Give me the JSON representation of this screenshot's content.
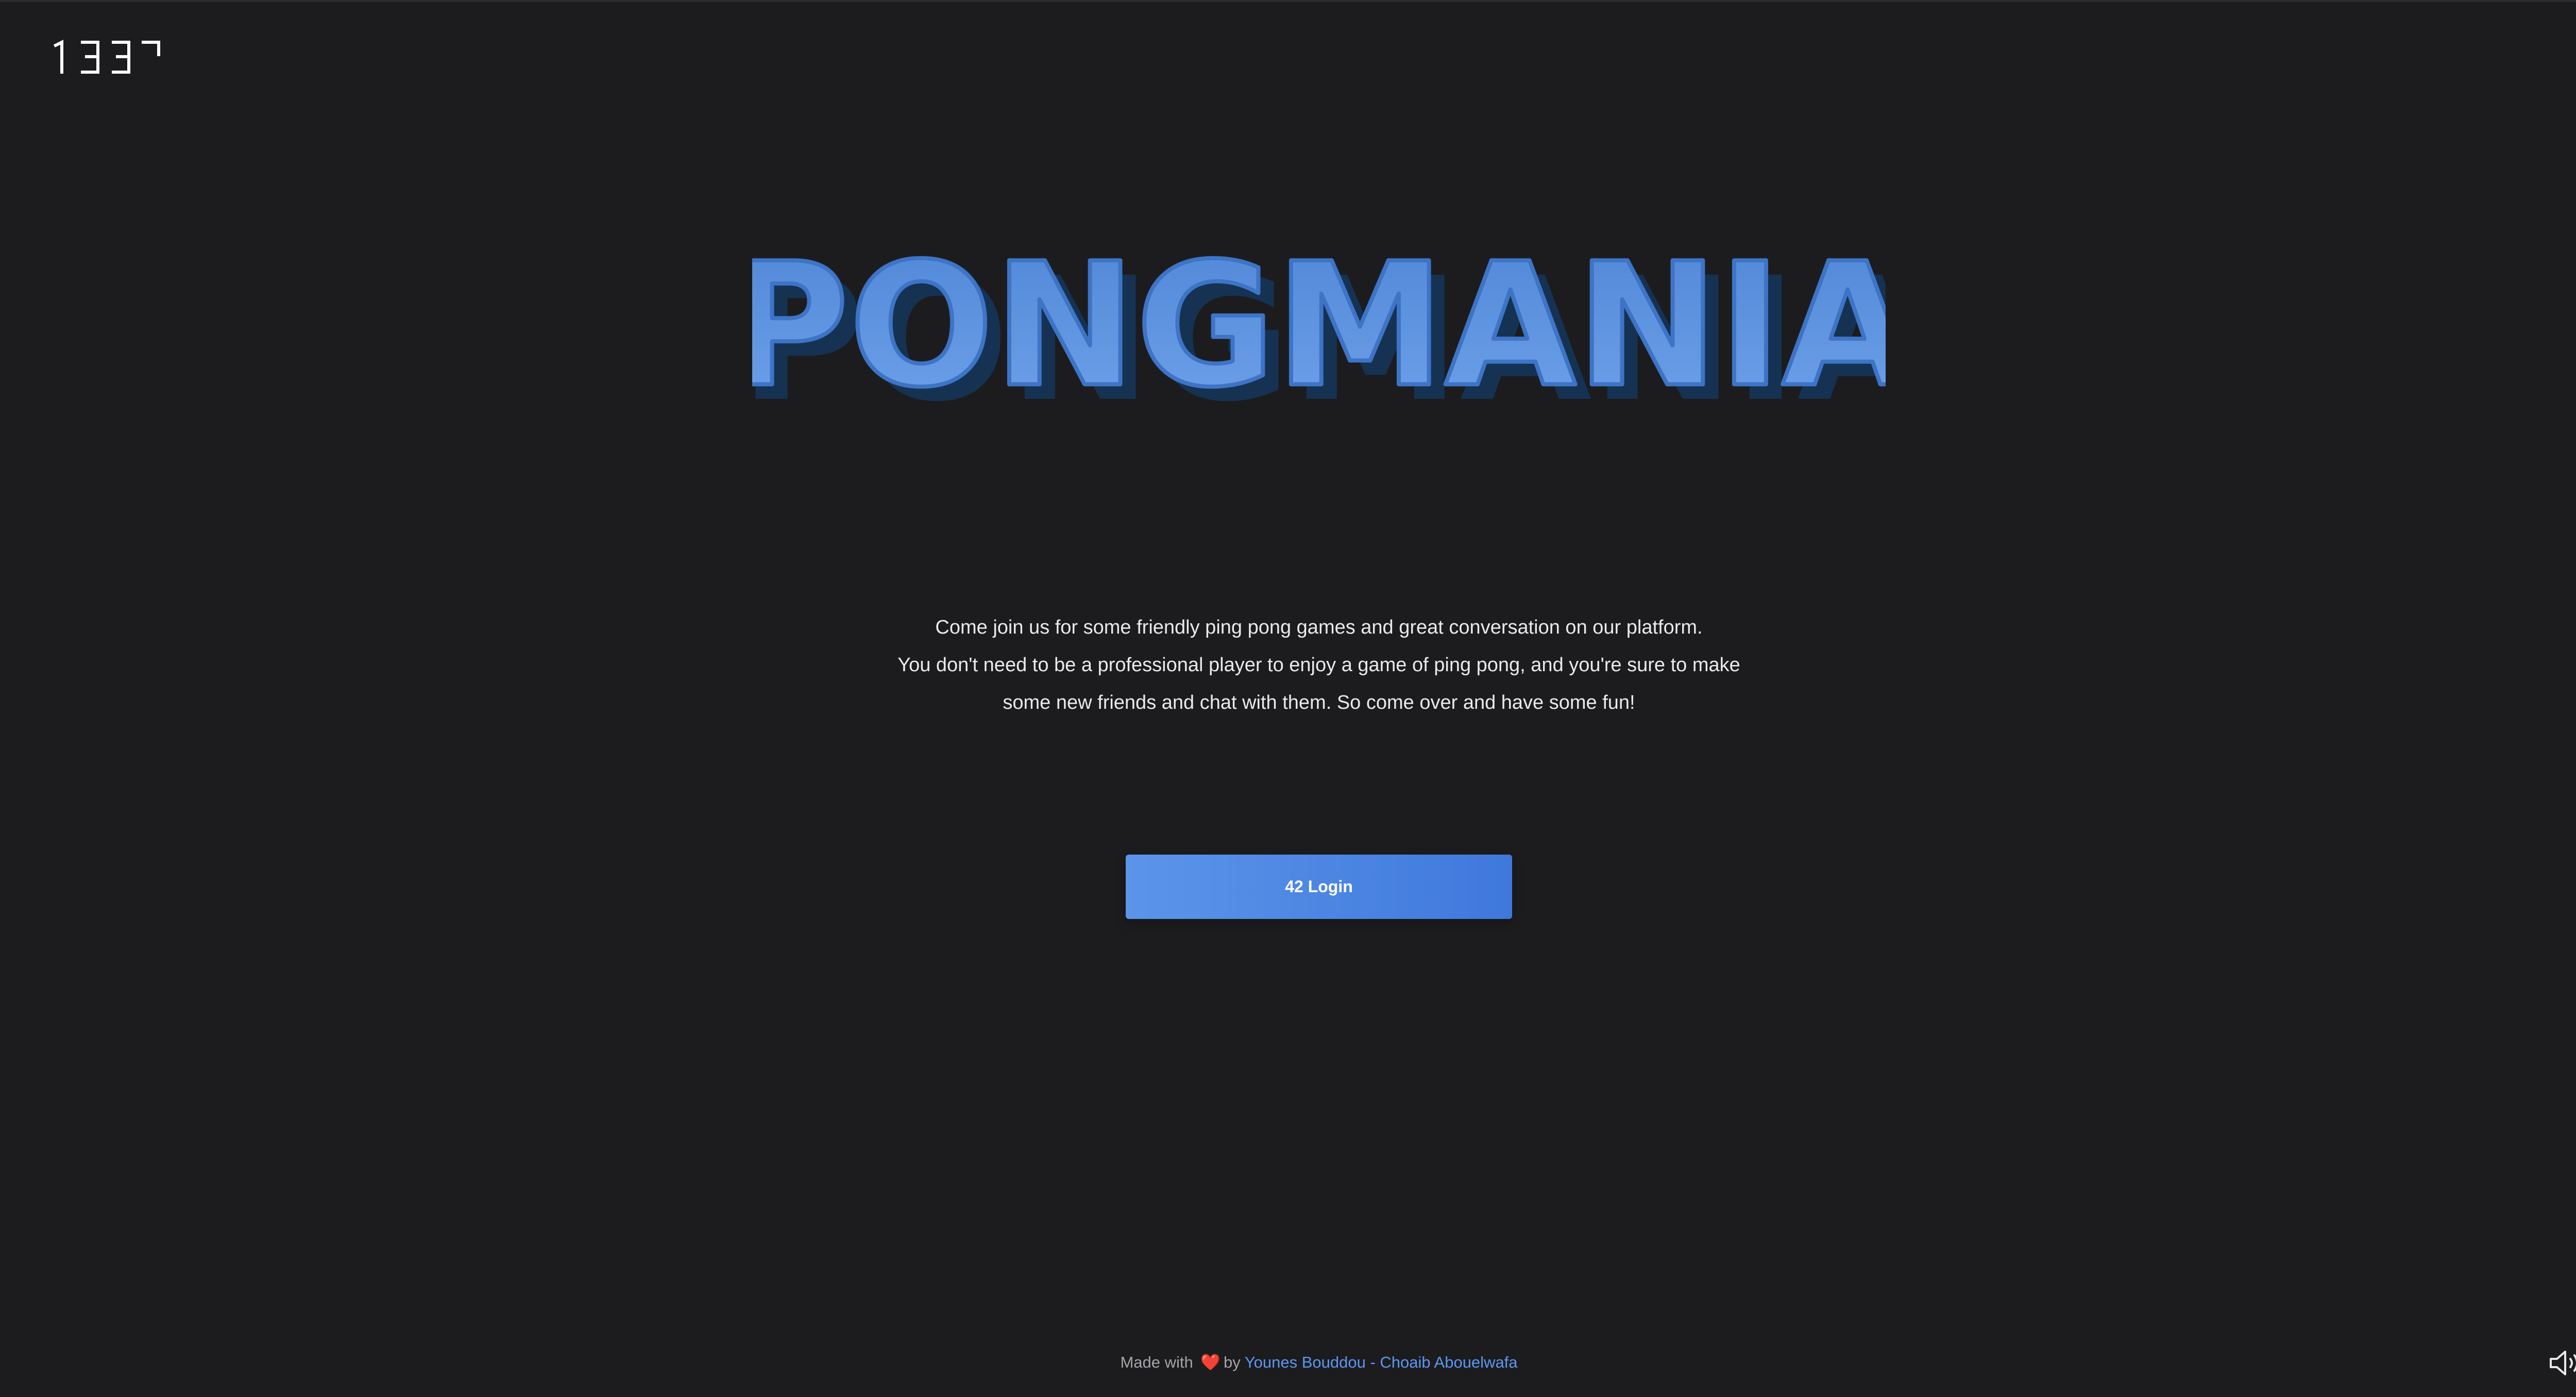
{
  "brand": {
    "logo_text": "1337",
    "title": "PONGMANIA",
    "title_color": "#5b93e3",
    "title_shadow_color": "#183a66"
  },
  "description": {
    "lines": [
      "Come join us for some friendly ping pong games and great conversation on our platform.",
      "You don't need to be a professional player to enjoy a game of ping pong, and you're sure to make",
      "some new friends and chat with them. So come over and have some fun!"
    ]
  },
  "login": {
    "label": "42 Login",
    "color": "#4a84e2"
  },
  "footer": {
    "prefix": "Made with",
    "heart": "❤️",
    "by": "by",
    "author1": "Younes Bouddou",
    "separator": "-",
    "author2": "Choaib Abouelwafa"
  },
  "sound": {
    "icon": "speaker-on-icon"
  }
}
